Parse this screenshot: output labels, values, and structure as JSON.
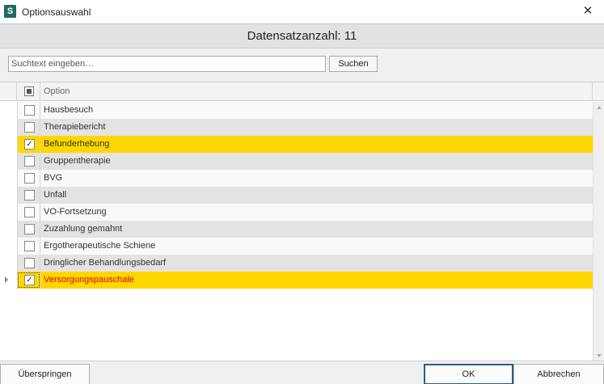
{
  "window": {
    "app_icon_letter": "S",
    "title": "Optionsauswahl",
    "close_glyph": "✕"
  },
  "header": {
    "record_count": "Datensatzanzahl: 11"
  },
  "search": {
    "placeholder": "Suchtext eingeben…",
    "value": "",
    "button_label": "Suchen"
  },
  "grid": {
    "column_header": "Option",
    "header_checkbox_state": "indeterminate",
    "rows": [
      {
        "label": "Hausbesuch",
        "checked": false
      },
      {
        "label": "Therapiebericht",
        "checked": false
      },
      {
        "label": "Befunderhebung",
        "checked": true
      },
      {
        "label": "Gruppentherapie",
        "checked": false
      },
      {
        "label": "BVG",
        "checked": false
      },
      {
        "label": "Unfall",
        "checked": false
      },
      {
        "label": "VO-Fortsetzung",
        "checked": false
      },
      {
        "label": "Zuzahlung gemahnt",
        "checked": false
      },
      {
        "label": "Ergotherapeutische Schiene",
        "checked": false
      },
      {
        "label": "Dringlicher Behandlungsbedarf",
        "checked": false
      },
      {
        "label": "Versorgungspauschale",
        "checked": true,
        "current": true
      }
    ]
  },
  "footer": {
    "skip_label": "Überspringen",
    "ok_label": "OK",
    "cancel_label": "Abbrechen"
  },
  "colors": {
    "selected_row": "#ffd700",
    "current_row_text": "#e00000",
    "app_icon": "#1d6b63"
  }
}
